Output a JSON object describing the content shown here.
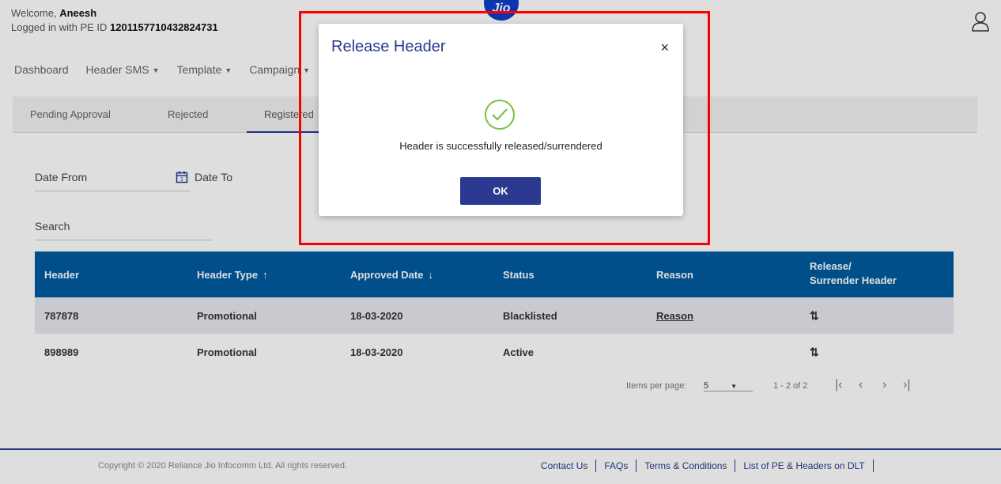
{
  "header": {
    "welcome_prefix": "Welcome,",
    "user_name": "Aneesh",
    "pe_prefix": "Logged in with PE ID",
    "pe_id": "1201157710432824731",
    "logo_text": "Jio"
  },
  "nav": {
    "items": [
      {
        "label": "Dashboard",
        "has_caret": false
      },
      {
        "label": "Header SMS",
        "has_caret": true
      },
      {
        "label": "Template",
        "has_caret": true
      },
      {
        "label": "Campaign",
        "has_caret": true
      }
    ]
  },
  "tabs": [
    {
      "label": "Pending Approval",
      "active": false
    },
    {
      "label": "Rejected",
      "active": false
    },
    {
      "label": "Registered",
      "active": true
    }
  ],
  "filters": {
    "date_from": "Date From",
    "date_to": "Date To",
    "search": "Search"
  },
  "table": {
    "headers": [
      "Header",
      "Header Type",
      "Approved Date",
      "Status",
      "Reason",
      "Release/",
      "Surrender Header"
    ],
    "rows": [
      {
        "header": "787878",
        "type": "Promotional",
        "date": "18-03-2020",
        "status": "Blacklisted",
        "reason": "Reason"
      },
      {
        "header": "898989",
        "type": "Promotional",
        "date": "18-03-2020",
        "status": "Active",
        "reason": ""
      }
    ]
  },
  "pager": {
    "items_per_page_label": "Items per page:",
    "items_per_page_value": "5",
    "range": "1 - 2 of 2"
  },
  "footer": {
    "copyright": "Copyright © 2020 Reliance Jio Infocomm Ltd. All rights reserved.",
    "links": [
      "Contact Us",
      "FAQs",
      "Terms & Conditions",
      "List of PE & Headers on DLT"
    ]
  },
  "modal": {
    "title": "Release Header",
    "close": "×",
    "message": "Header is successfully released/surrendered",
    "ok_label": "OK"
  },
  "colors": {
    "brand": "#2b3990",
    "table_header": "#005b9f",
    "success": "#7ac143",
    "highlight": "#ff0000"
  }
}
